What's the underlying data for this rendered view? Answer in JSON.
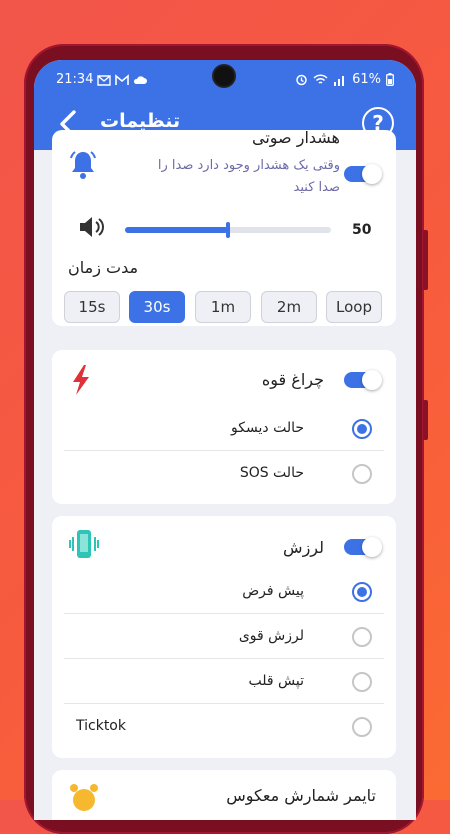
{
  "status_bar": {
    "time": "21:34",
    "battery": "61%"
  },
  "app_bar": {
    "title": "تنظیمات",
    "help_label": "?"
  },
  "sound_alarm": {
    "title": "هشدار صوتی",
    "description_line1": "وقتی یک هشدار وجود دارد صدا را",
    "description_line2": "صدا کنید",
    "toggle_on": true,
    "volume_value": "50",
    "volume_fraction": 0.5,
    "duration_label": "مدت زمان",
    "durations": [
      "15s",
      "30s",
      "1m",
      "2m",
      "Loop"
    ],
    "selected_duration": "30s"
  },
  "flashlight": {
    "title": "چراغ قوه",
    "toggle_on": true,
    "options": [
      "حالت دیسکو",
      "حالت SOS"
    ],
    "selected_index": 0
  },
  "vibration": {
    "title": "لرزش",
    "toggle_on": true,
    "options": [
      "پیش فرض",
      "لرزش قوی",
      "تپش قلب",
      "Ticktok"
    ],
    "selected_index": 0
  },
  "next_card": {
    "title": "تایمر شمارش معکوس"
  },
  "colors": {
    "accent": "#3d72e6",
    "danger": "#e0313a",
    "teal": "#2ec4b6",
    "bell": "#3d72e6",
    "alarm_clock": "#f5b82e"
  }
}
